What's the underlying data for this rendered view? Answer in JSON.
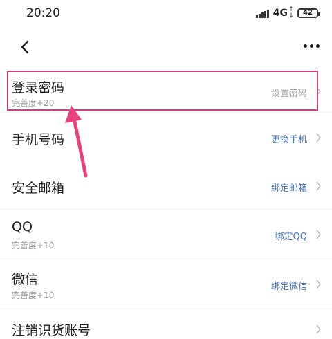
{
  "status_bar": {
    "time": "20:20",
    "network": "4G",
    "battery": "42"
  },
  "nav": {
    "back_icon": "chevron-left-icon",
    "more_icon": "more-dots-icon"
  },
  "rows": [
    {
      "title": "登录密码",
      "subtitle": "完善度+20",
      "action": "设置密码"
    },
    {
      "title": "手机号码",
      "subtitle": "",
      "action": "更换手机"
    },
    {
      "title": "安全邮箱",
      "subtitle": "",
      "action": "绑定邮箱"
    },
    {
      "title": "QQ",
      "subtitle": "完善度+10",
      "action": "绑定QQ"
    },
    {
      "title": "微信",
      "subtitle": "完善度+10",
      "action": "绑定微信"
    },
    {
      "title": "注销识货账号",
      "subtitle": "",
      "action": ""
    }
  ],
  "colors": {
    "action_link": "#4a74b8",
    "highlight": "#c9427f",
    "annotation_arrow": "#e8417e"
  }
}
